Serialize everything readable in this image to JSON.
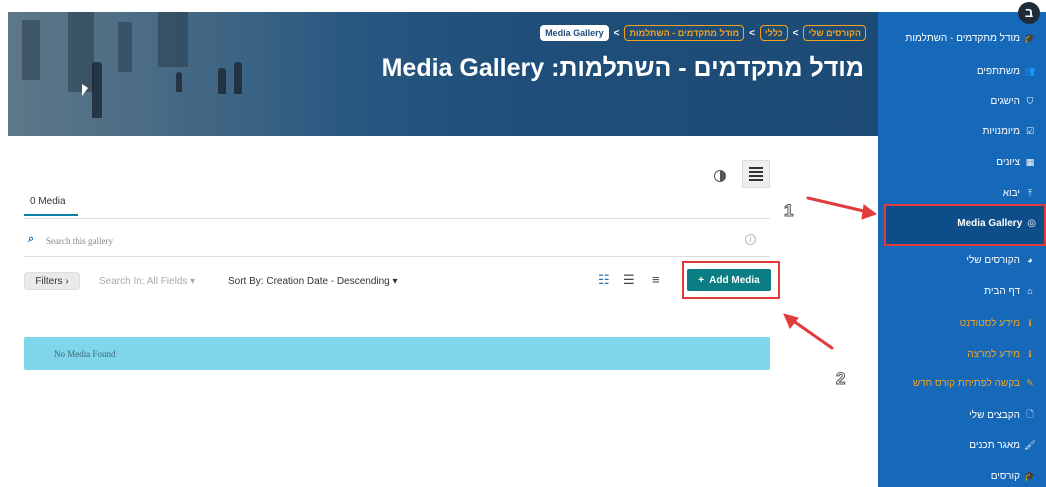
{
  "breadcrumb": [
    {
      "label": "הקורסים שלי"
    },
    {
      "label": "כללי"
    },
    {
      "label": "מודל מתקדמים - השתלמות"
    },
    {
      "label": "Media Gallery"
    }
  ],
  "breadcrumb_separator": "<",
  "page_title": "מודל מתקדמים - השתלמות: Media Gallery",
  "sidebar": {
    "badge": "ב",
    "items": [
      {
        "label": "מודל מתקדמים - השתלמות",
        "icon": "graduation-cap-icon",
        "glyph": "🎓"
      },
      {
        "label": "משתתפים",
        "icon": "users-icon",
        "glyph": "👥"
      },
      {
        "label": "הישגים",
        "icon": "shield-icon",
        "glyph": "⛉"
      },
      {
        "label": "מיומנויות",
        "icon": "check-square-icon",
        "glyph": "☑"
      },
      {
        "label": "ציונים",
        "icon": "table-icon",
        "glyph": "▦"
      },
      {
        "label": "יבוא",
        "icon": "upload-icon",
        "glyph": "⤒"
      },
      {
        "label": "Media Gallery",
        "icon": "media-icon",
        "glyph": "◎"
      },
      {
        "label": "הקורסים שלי",
        "icon": "dashboard-icon",
        "glyph": "◕"
      },
      {
        "label": "דף הבית",
        "icon": "home-icon",
        "glyph": "⌂"
      },
      {
        "label": "מידע לסטודנט",
        "icon": "info-icon",
        "glyph": "ℹ"
      },
      {
        "label": "מידע למרצה",
        "icon": "info-icon",
        "glyph": "ℹ"
      },
      {
        "label": "בקשה לפתיחת קורס חדש",
        "icon": "pencil-icon",
        "glyph": "✎"
      },
      {
        "label": "הקבצים שלי",
        "icon": "file-icon",
        "glyph": "🗋"
      },
      {
        "label": "מאגר תכנים",
        "icon": "brush-icon",
        "glyph": "🖌"
      },
      {
        "label": "קורסים",
        "icon": "graduation-cap-icon",
        "glyph": "🎓"
      }
    ]
  },
  "tabs": {
    "media": "0 Media"
  },
  "search": {
    "placeholder": "Search this gallery",
    "info_glyph": "i"
  },
  "toolbar": {
    "filters_label": "Filters  ›",
    "search_in_label": "Search In: All Fields ▾",
    "sort_by_label": "Sort By: Creation Date - Descending ▾",
    "add_media_plus": "+",
    "add_media_label": "Add Media"
  },
  "empty_state": "No Media Found",
  "annotations": {
    "one": "1",
    "two": "2"
  },
  "colors": {
    "sidebar_bg": "#1668b8",
    "sidebar_active_bg": "#0d4d8a",
    "accent_orange": "#f6a21e",
    "add_media_bg": "#0a7e82",
    "empty_state_bg": "#7fd6ea",
    "annotation_red": "#e23b3b"
  }
}
